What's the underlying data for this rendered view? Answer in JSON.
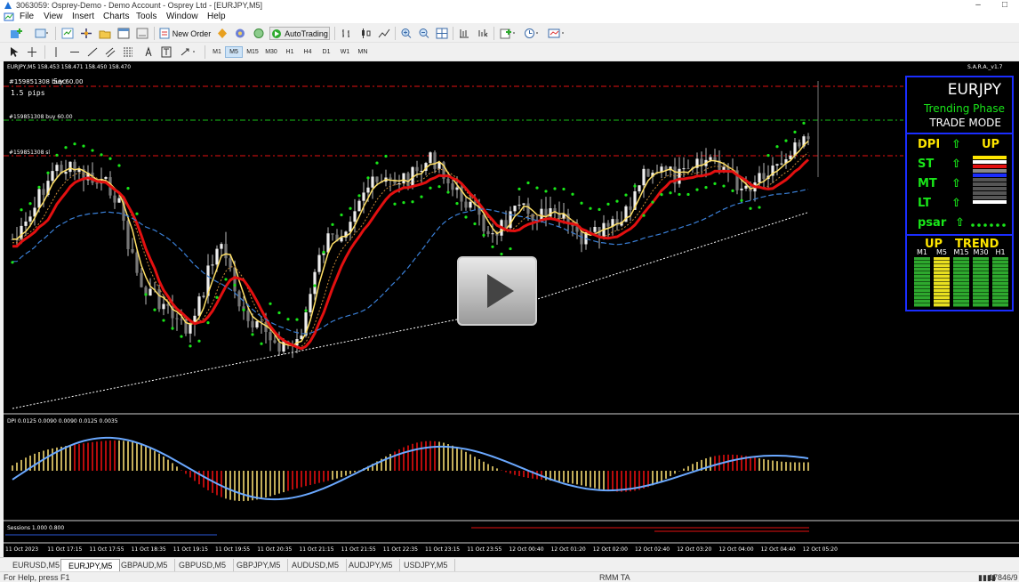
{
  "window": {
    "title": "3063059: Osprey-Demo - Demo Account - Osprey Ltd - [EURJPY,M5]",
    "minimize": "–",
    "maximize": "□"
  },
  "menu": [
    "File",
    "View",
    "Insert",
    "Charts",
    "Tools",
    "Window",
    "Help"
  ],
  "toolbar": {
    "new_order": "New Order",
    "autotrading": "AutoTrading"
  },
  "timeframes": [
    "M1",
    "M5",
    "M15",
    "M30",
    "H1",
    "H4",
    "D1",
    "W1",
    "MN"
  ],
  "active_timeframe": "M5",
  "chart": {
    "header": "EURJPY,M5  158.453 158.471 158.450 158.470",
    "indicator_name": "S.A.R.A._v1.7",
    "overlay_line1": "#159851308 buy 60.00",
    "overlay_sec": "Sec",
    "spread": "1.5 pips",
    "order_buy": "#159851308 buy 60.00",
    "order_sl": "#159851308 sl",
    "dpi_header": "DPI 0.0125 0.0090 0.0090 0.0125 0.0035",
    "sessions_header": "Sessions 1.000 0.800",
    "time_labels": [
      "11 Oct 2023",
      "11 Oct 17:15",
      "11 Oct 17:55",
      "11 Oct 18:35",
      "11 Oct 19:15",
      "11 Oct 19:55",
      "11 Oct 20:35",
      "11 Oct 21:15",
      "11 Oct 21:55",
      "11 Oct 22:35",
      "11 Oct 23:15",
      "11 Oct 23:55",
      "12 Oct 00:40",
      "12 Oct 01:20",
      "12 Oct 02:00",
      "12 Oct 02:40",
      "12 Oct 03:20",
      "12 Oct 04:00",
      "12 Oct 04:40",
      "12 Oct 05:20"
    ]
  },
  "sara_panel": {
    "symbol": "EURJPY",
    "phase": "Trending Phase",
    "mode": "TRADE MODE",
    "rows": [
      {
        "label": "DPI",
        "arrow": "⇧",
        "color": "#ffe600"
      },
      {
        "label": "ST",
        "arrow": "⇧",
        "color": "#19e619"
      },
      {
        "label": "MT",
        "arrow": "⇧",
        "color": "#19e619"
      },
      {
        "label": "LT",
        "arrow": "⇧",
        "color": "#19e619"
      },
      {
        "label": "psar",
        "arrow": "⇧",
        "color": "#19e619"
      }
    ],
    "dpi_direction": "UP",
    "trend_direction": "UP",
    "trend_label": "TREND",
    "trend_timeframes": [
      "M1",
      "M5",
      "M15",
      "M30",
      "H1"
    ],
    "colors": {
      "border": "#1a2dff",
      "up": "#19e619",
      "dpi": "#ffe600"
    }
  },
  "symbol_tabs": [
    "EURUSD,M5",
    "EURJPY,M5",
    "GBPAUD,M5",
    "GBPUSD,M5",
    "GBPJPY,M5",
    "AUDUSD,M5",
    "AUDJPY,M5",
    "USDJPY,M5"
  ],
  "active_tab": "EURJPY,M5",
  "status": {
    "help": "For Help, press F1",
    "profile": "RMM TA",
    "traffic": "17846/9 k"
  }
}
